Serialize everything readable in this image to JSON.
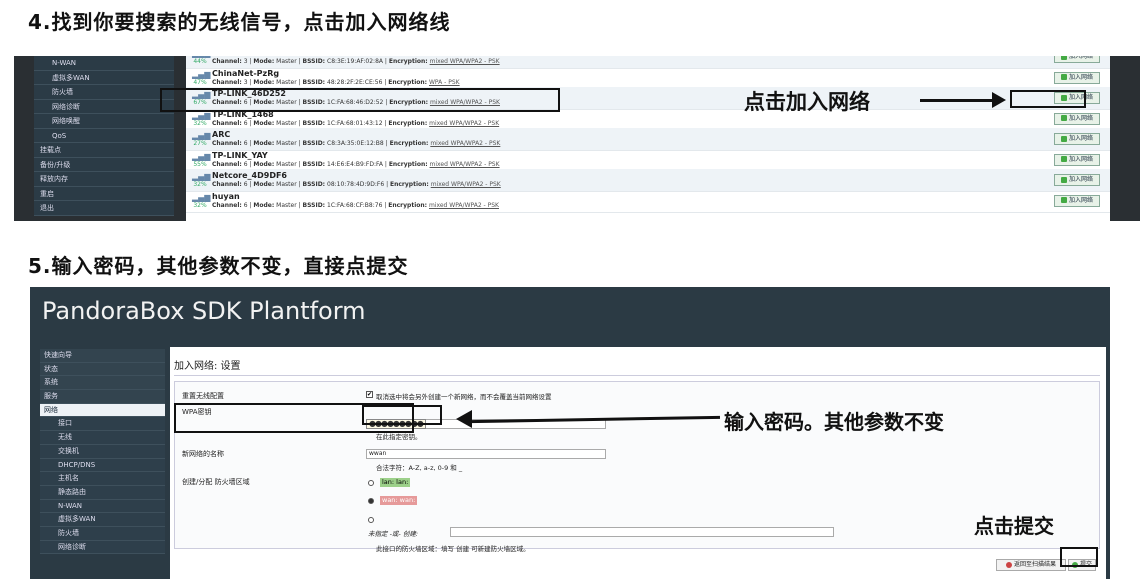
{
  "step4": {
    "title": "4.找到你要搜索的无线信号，点击加入网络线"
  },
  "step5": {
    "title": "5.输入密码，其他参数不变，直接点提交"
  },
  "shot1": {
    "sidebar": [
      {
        "label": "N-WAN",
        "top": false
      },
      {
        "label": "虚拟多WAN",
        "top": false
      },
      {
        "label": "防火墙",
        "top": false
      },
      {
        "label": "网络诊断",
        "top": false
      },
      {
        "label": "网络唤醒",
        "top": false
      },
      {
        "label": "QoS",
        "top": false
      },
      {
        "label": "挂载点",
        "top": true
      },
      {
        "label": "备份/升级",
        "top": true
      },
      {
        "label": "释放内存",
        "top": true
      },
      {
        "label": "重启",
        "top": true
      },
      {
        "label": "退出",
        "top": true
      }
    ],
    "networks": [
      {
        "signal": "44%",
        "ssid": "",
        "channel": "3",
        "mode": "Master",
        "bssid": "C8:3E:19:AF:02:8A",
        "encryption": "mixed WPA/WPA2 - PSK"
      },
      {
        "signal": "47%",
        "ssid": "ChinaNet-PzRg",
        "channel": "3",
        "mode": "Master",
        "bssid": "48:28:2F:2E:CE:56",
        "encryption": "WPA - PSK"
      },
      {
        "signal": "67%",
        "ssid": "TP-LINK_46D252",
        "channel": "6",
        "mode": "Master",
        "bssid": "1C:FA:68:46:D2:52",
        "encryption": "mixed WPA/WPA2 - PSK"
      },
      {
        "signal": "32%",
        "ssid": "TP-LINK_1468",
        "channel": "6",
        "mode": "Master",
        "bssid": "1C:FA:68:01:43:12",
        "encryption": "mixed WPA/WPA2 - PSK"
      },
      {
        "signal": "27%",
        "ssid": "ARC",
        "channel": "6",
        "mode": "Master",
        "bssid": "C8:3A:35:0E:12:B8",
        "encryption": "mixed WPA/WPA2 - PSK"
      },
      {
        "signal": "55%",
        "ssid": "TP-LINK_YAY",
        "channel": "6",
        "mode": "Master",
        "bssid": "14:E6:E4:B9:FD:FA",
        "encryption": "mixed WPA/WPA2 - PSK"
      },
      {
        "signal": "32%",
        "ssid": "Netcore_4D9DF6",
        "channel": "6",
        "mode": "Master",
        "bssid": "08:10:78:4D:9D:F6",
        "encryption": "mixed WPA/WPA2 - PSK"
      },
      {
        "signal": "32%",
        "ssid": "huyan",
        "channel": "6",
        "mode": "Master",
        "bssid": "1C:FA:68:CF:B8:76",
        "encryption": "mixed WPA/WPA2 - PSK"
      }
    ],
    "labels": {
      "channel": "Channel:",
      "mode": "Mode:",
      "bssid": "BSSID:",
      "encryption": "Encryption:"
    },
    "join_button": "加入网络",
    "annotation": "点击加入网络"
  },
  "shot2": {
    "header": "PandoraBox SDK Plantform",
    "sidebar": [
      {
        "label": "快速向导",
        "cls": "top"
      },
      {
        "label": "状态",
        "cls": "top"
      },
      {
        "label": "系统",
        "cls": "top"
      },
      {
        "label": "服务",
        "cls": "top"
      },
      {
        "label": "网络",
        "cls": "act"
      },
      {
        "label": "接口",
        "cls": ""
      },
      {
        "label": "无线",
        "cls": ""
      },
      {
        "label": "交换机",
        "cls": ""
      },
      {
        "label": "DHCP/DNS",
        "cls": ""
      },
      {
        "label": "主机名",
        "cls": ""
      },
      {
        "label": "静态路由",
        "cls": ""
      },
      {
        "label": "N-WAN",
        "cls": ""
      },
      {
        "label": "虚拟多WAN",
        "cls": ""
      },
      {
        "label": "防火墙",
        "cls": ""
      },
      {
        "label": "网络诊断",
        "cls": ""
      }
    ],
    "panel_title": "加入网络: 设置",
    "form": {
      "replace_label": "重置无线配置",
      "replace_desc": "勾选此选项将会关闭并删除所有现有的无线网络，新建一个新的无线网络！",
      "replace_hint": "取消选中将会另外创建一个新网络，而不会覆盖当前网络设置",
      "wpa_label": "WPA密钥",
      "wpa_value": "●●●●●●●●●",
      "wpa_hint": "在此指定密钥。",
      "name_label": "新网络的名称",
      "name_value": "wwan",
      "name_hint": "合法字符：A-Z, a-z, 0-9 和 _",
      "fw_label": "创建/分配 防火墙区域",
      "fw_lan": "lan: lan:",
      "fw_wan": "wan: wan:",
      "fw_custom": "未指定 -或- 创建:",
      "fw_hint": "此接口的防火墙区域：填写 创建 可新建防火墙区域。"
    },
    "annotation_pw": "输入密码。其他参数不变",
    "annotation_submit": "点击提交",
    "reset_button": "返回至扫描结果",
    "submit_button": "提交"
  }
}
